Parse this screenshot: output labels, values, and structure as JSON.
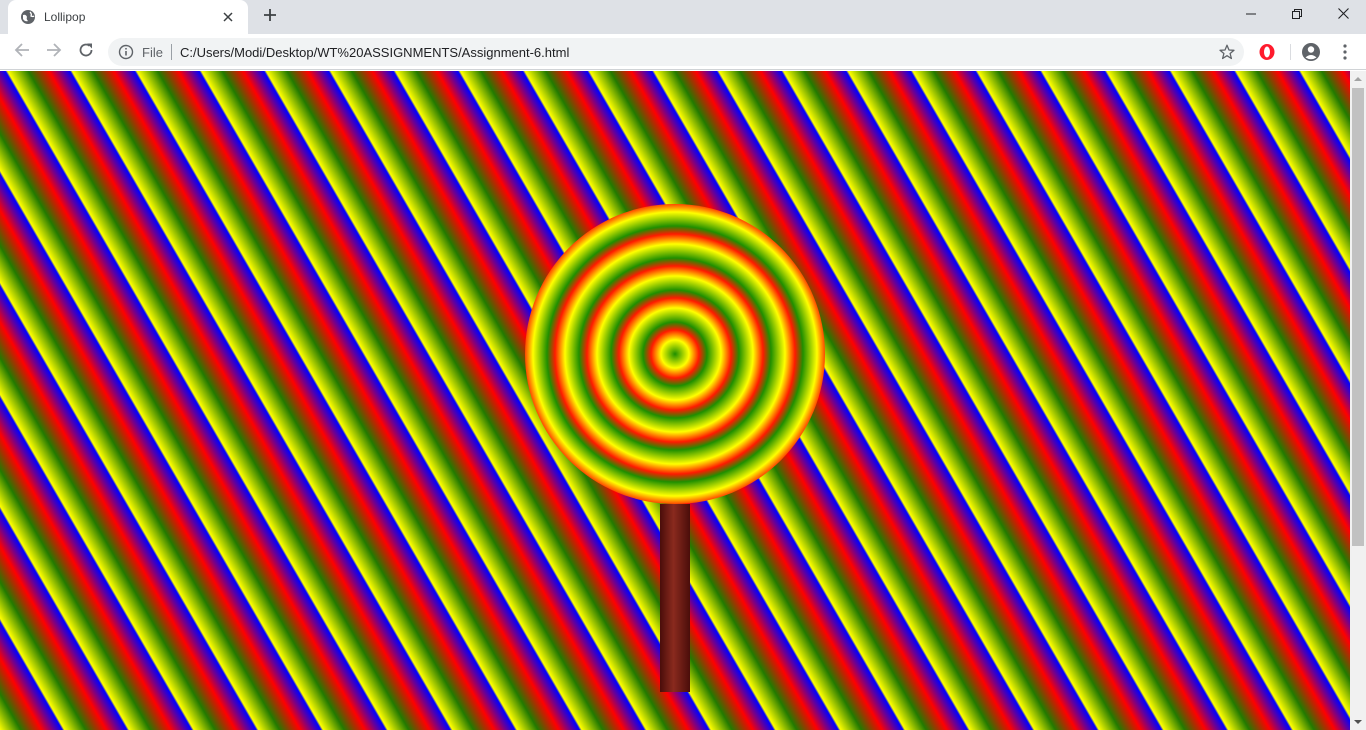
{
  "tab": {
    "title": "Lollipop",
    "favicon": "globe-icon"
  },
  "toolbar": {
    "scheme_label": "File",
    "url": "C:/Users/Modi/Desktop/WT%20ASSIGNMENTS/Assignment-6.html"
  },
  "icons": {
    "tab_close": "close-icon",
    "new_tab": "plus-icon",
    "back": "back-arrow-icon",
    "forward": "forward-arrow-icon",
    "reload": "reload-icon",
    "site_info": "info-icon",
    "bookmark": "star-icon",
    "extension": "opera-icon",
    "profile": "account-icon",
    "menu": "more-vert-icon",
    "minimize": "minimize-icon",
    "maximize": "restore-icon",
    "close_window": "close-icon"
  },
  "page": {
    "background_colors": [
      "#ffff00",
      "#227a00",
      "#ff0000",
      "#0000ff"
    ],
    "candy_colors": [
      "#1f8f00",
      "#ffff00",
      "#ff1a00"
    ],
    "stick_color": "#6b1c14"
  }
}
